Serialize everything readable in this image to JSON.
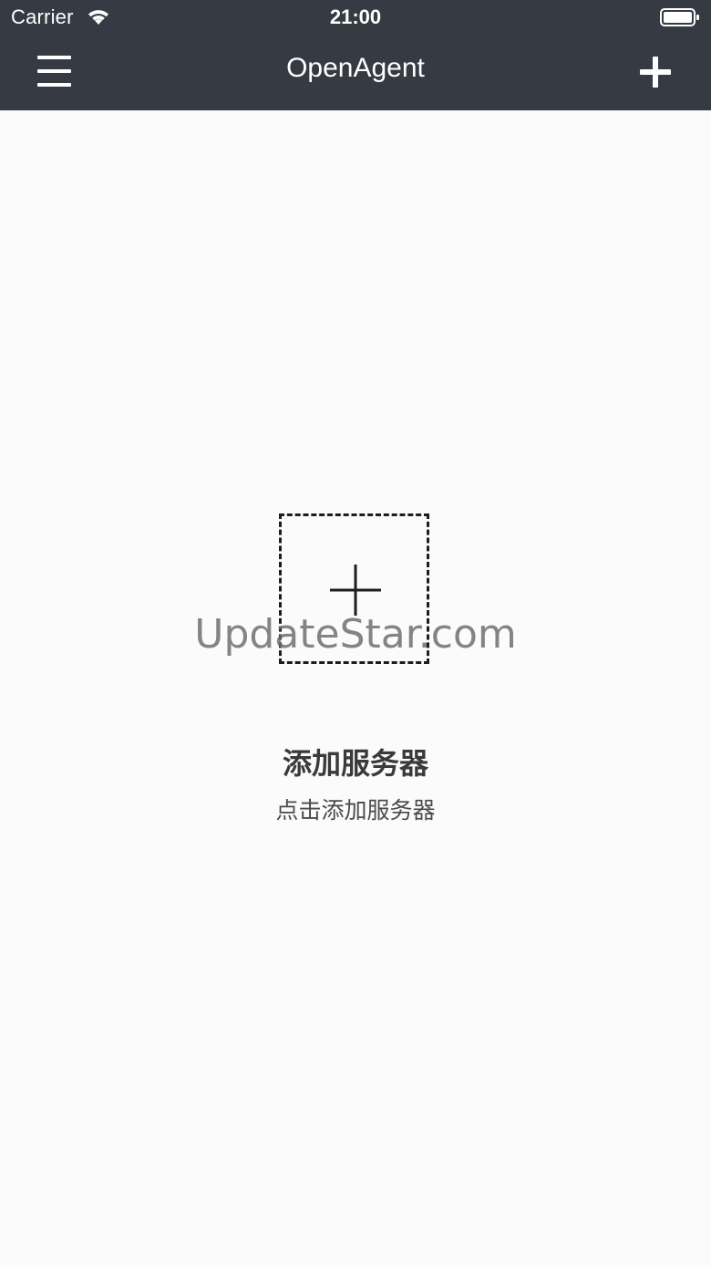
{
  "status_bar": {
    "carrier": "Carrier",
    "time": "21:00",
    "wifi_icon": "wifi-icon",
    "battery_icon": "battery-full-icon"
  },
  "nav_bar": {
    "menu_icon": "hamburger-menu-icon",
    "title": "OpenAgent",
    "add_icon": "plus-icon"
  },
  "empty_state": {
    "add_icon": "plus-icon",
    "title": "添加服务器",
    "subtitle": "点击添加服务器"
  },
  "watermark": "UpdateStar.com",
  "colors": {
    "header_bg": "#363b43",
    "page_bg": "#fbfbfb",
    "text_dark": "#3a3a3a"
  }
}
